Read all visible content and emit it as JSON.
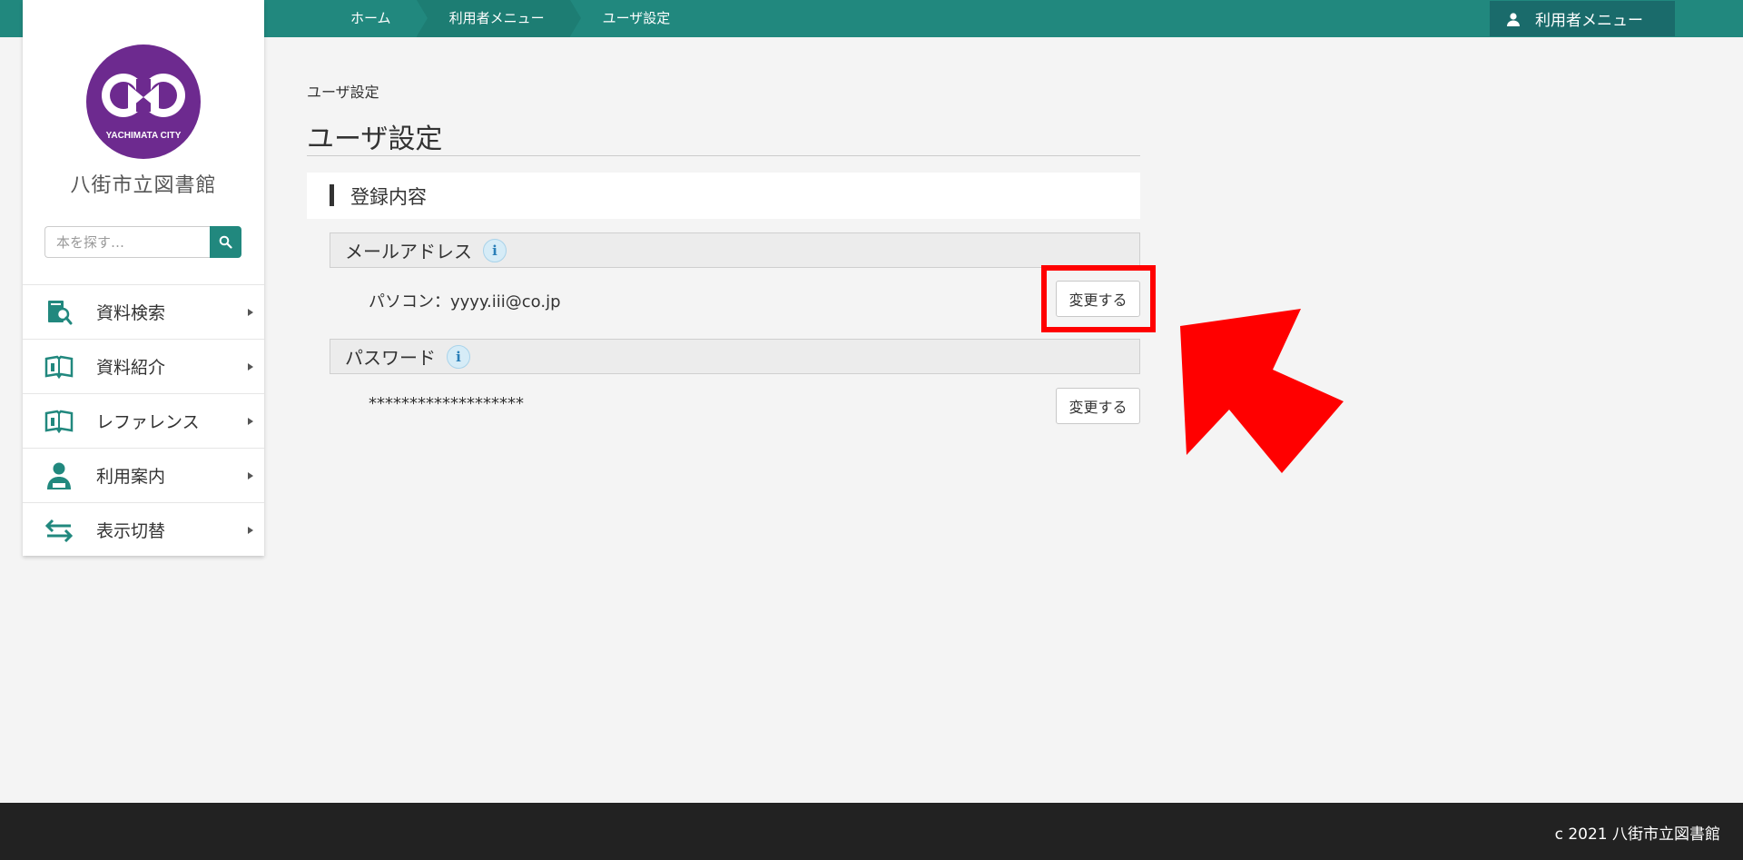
{
  "breadcrumbs": [
    "ホーム",
    "利用者メニュー",
    "ユーザ設定"
  ],
  "header": {
    "user_menu_label": "利用者メニュー"
  },
  "sidebar": {
    "logo_text": "YACHIMATA CITY",
    "library_name": "八街市立図書館",
    "search_placeholder": "本を探す…",
    "items": [
      {
        "label": "資料検索",
        "icon": "catalog-search-icon"
      },
      {
        "label": "資料紹介",
        "icon": "open-book-icon"
      },
      {
        "label": "レファレンス",
        "icon": "open-book-icon"
      },
      {
        "label": "利用案内",
        "icon": "person-guide-icon"
      },
      {
        "label": "表示切替",
        "icon": "switch-arrows-icon"
      }
    ]
  },
  "main": {
    "breadcrumb_current": "ユーザ設定",
    "page_title": "ユーザ設定",
    "section_title": "登録内容",
    "email": {
      "label": "メールアドレス",
      "value": "パソコン：yyyy.iii@co.jp",
      "button": "変更する"
    },
    "password": {
      "label": "パスワード",
      "value": "*******************",
      "button": "変更する"
    }
  },
  "footer": {
    "copyright": "c 2021 八街市立図書館"
  },
  "colors": {
    "accent": "#21887e",
    "highlight": "#ff0000",
    "footer": "#222222"
  }
}
